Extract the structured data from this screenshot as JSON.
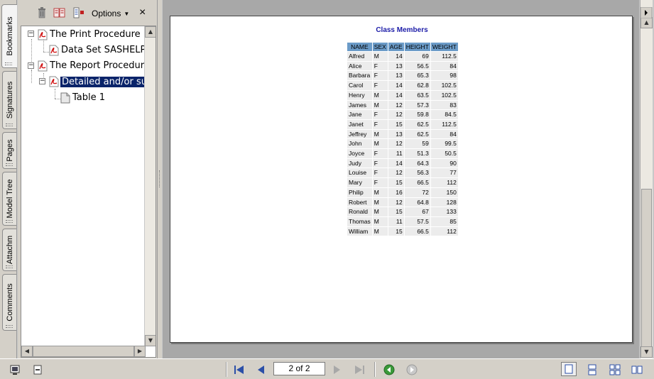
{
  "nav_tabs": [
    {
      "label": "Bookmarks",
      "active": true
    },
    {
      "label": "Signatures",
      "active": false
    },
    {
      "label": "Pages",
      "active": false
    },
    {
      "label": "Model Tree",
      "active": false
    },
    {
      "label": "Attachm",
      "active": false
    },
    {
      "label": "Comments",
      "active": false
    }
  ],
  "panel_toolbar": {
    "delete_icon": "trash-icon",
    "new_bookmark_icon": "new-bookmark-icon",
    "expand_icon": "expand-bookmark-icon",
    "options_label": "Options",
    "close_glyph": "×"
  },
  "bookmarks": [
    {
      "label": "The Print Procedure",
      "level": 0,
      "expanded": true
    },
    {
      "label": "Data Set SASHELP.",
      "level": 1
    },
    {
      "label": "The Report Procedure",
      "level": 0,
      "expanded": true
    },
    {
      "label": "Detailed and/or sumi",
      "level": 1,
      "selected": true,
      "expanded": true
    },
    {
      "label": "Table 1",
      "level": 2
    }
  ],
  "report": {
    "title": "Class Members",
    "columns": [
      "NAME",
      "SEX",
      "AGE",
      "HEIGHT",
      "WEIGHT"
    ],
    "rows": [
      [
        "Alfred",
        "M",
        "14",
        "69",
        "112.5"
      ],
      [
        "Alice",
        "F",
        "13",
        "56.5",
        "84"
      ],
      [
        "Barbara",
        "F",
        "13",
        "65.3",
        "98"
      ],
      [
        "Carol",
        "F",
        "14",
        "62.8",
        "102.5"
      ],
      [
        "Henry",
        "M",
        "14",
        "63.5",
        "102.5"
      ],
      [
        "James",
        "M",
        "12",
        "57.3",
        "83"
      ],
      [
        "Jane",
        "F",
        "12",
        "59.8",
        "84.5"
      ],
      [
        "Janet",
        "F",
        "15",
        "62.5",
        "112.5"
      ],
      [
        "Jeffrey",
        "M",
        "13",
        "62.5",
        "84"
      ],
      [
        "John",
        "M",
        "12",
        "59",
        "99.5"
      ],
      [
        "Joyce",
        "F",
        "11",
        "51.3",
        "50.5"
      ],
      [
        "Judy",
        "F",
        "14",
        "64.3",
        "90"
      ],
      [
        "Louise",
        "F",
        "12",
        "56.3",
        "77"
      ],
      [
        "Mary",
        "F",
        "15",
        "66.5",
        "112"
      ],
      [
        "Philip",
        "M",
        "16",
        "72",
        "150"
      ],
      [
        "Robert",
        "M",
        "12",
        "64.8",
        "128"
      ],
      [
        "Ronald",
        "M",
        "15",
        "67",
        "133"
      ],
      [
        "Thomas",
        "M",
        "11",
        "57.5",
        "85"
      ],
      [
        "William",
        "M",
        "15",
        "66.5",
        "112"
      ]
    ]
  },
  "navigation": {
    "page_indicator": "2 of 2"
  },
  "colors": {
    "header_bg": "#6b9bc8",
    "title": "#1c1ca8",
    "selection": "#0a246a"
  }
}
